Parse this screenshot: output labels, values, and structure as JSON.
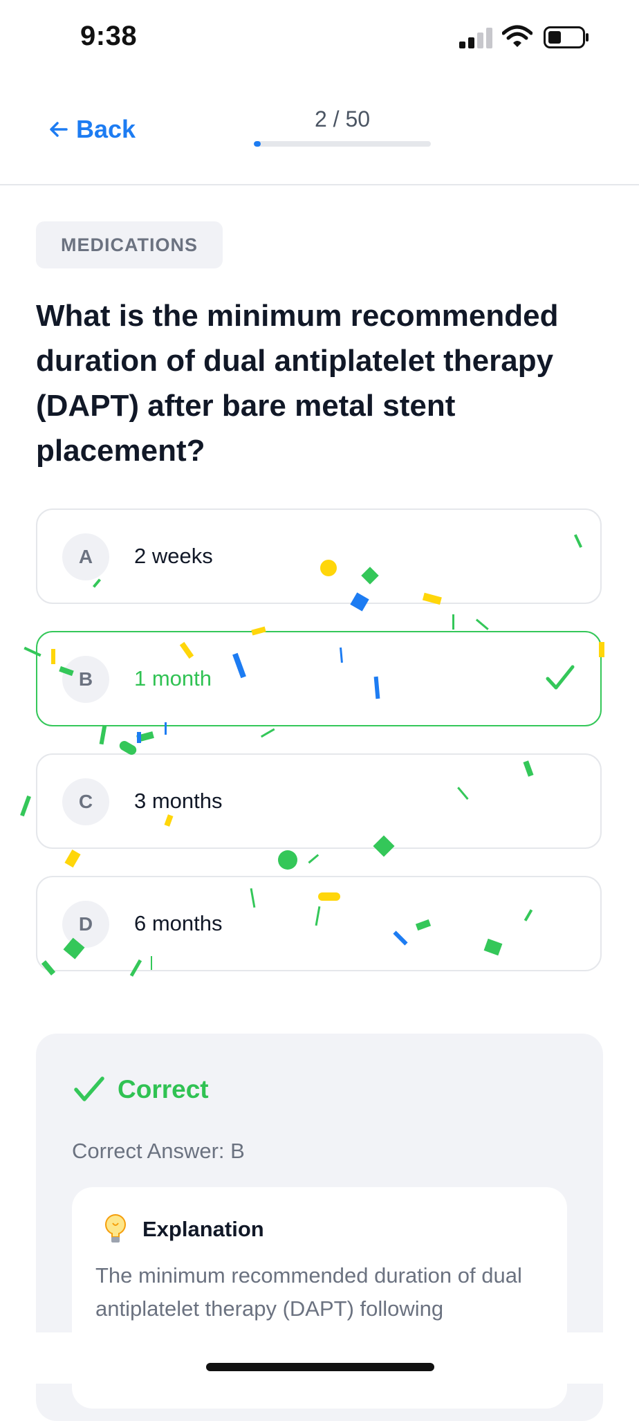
{
  "status_bar": {
    "time": "9:38"
  },
  "header": {
    "back_label": "Back",
    "progress_text": "2 / 50",
    "progress": {
      "current": 2,
      "total": 50
    }
  },
  "category": "MEDICATIONS",
  "question": "What is the minimum recommended duration of dual antiplatelet therapy (DAPT) after bare metal stent placement?",
  "options": [
    {
      "letter": "A",
      "text": "2 weeks"
    },
    {
      "letter": "B",
      "text": "1 month",
      "state": "correct"
    },
    {
      "letter": "C",
      "text": "3 months"
    },
    {
      "letter": "D",
      "text": "6 months"
    }
  ],
  "feedback": {
    "title": "Correct",
    "correct_answer": "Correct Answer: B",
    "explanation_title": "Explanation",
    "explanation_text": "The minimum recommended duration of dual antiplatelet therapy (DAPT) following"
  },
  "colors": {
    "accent": "#1d7cf2",
    "correct": "#34c759",
    "confetti": [
      "#34c759",
      "#1d7cf2",
      "#ffd60a"
    ]
  },
  "icons": [
    "arrow-left-icon",
    "checkmark-icon",
    "lightbulb-icon",
    "signal-icon",
    "wifi-icon",
    "battery-icon"
  ]
}
